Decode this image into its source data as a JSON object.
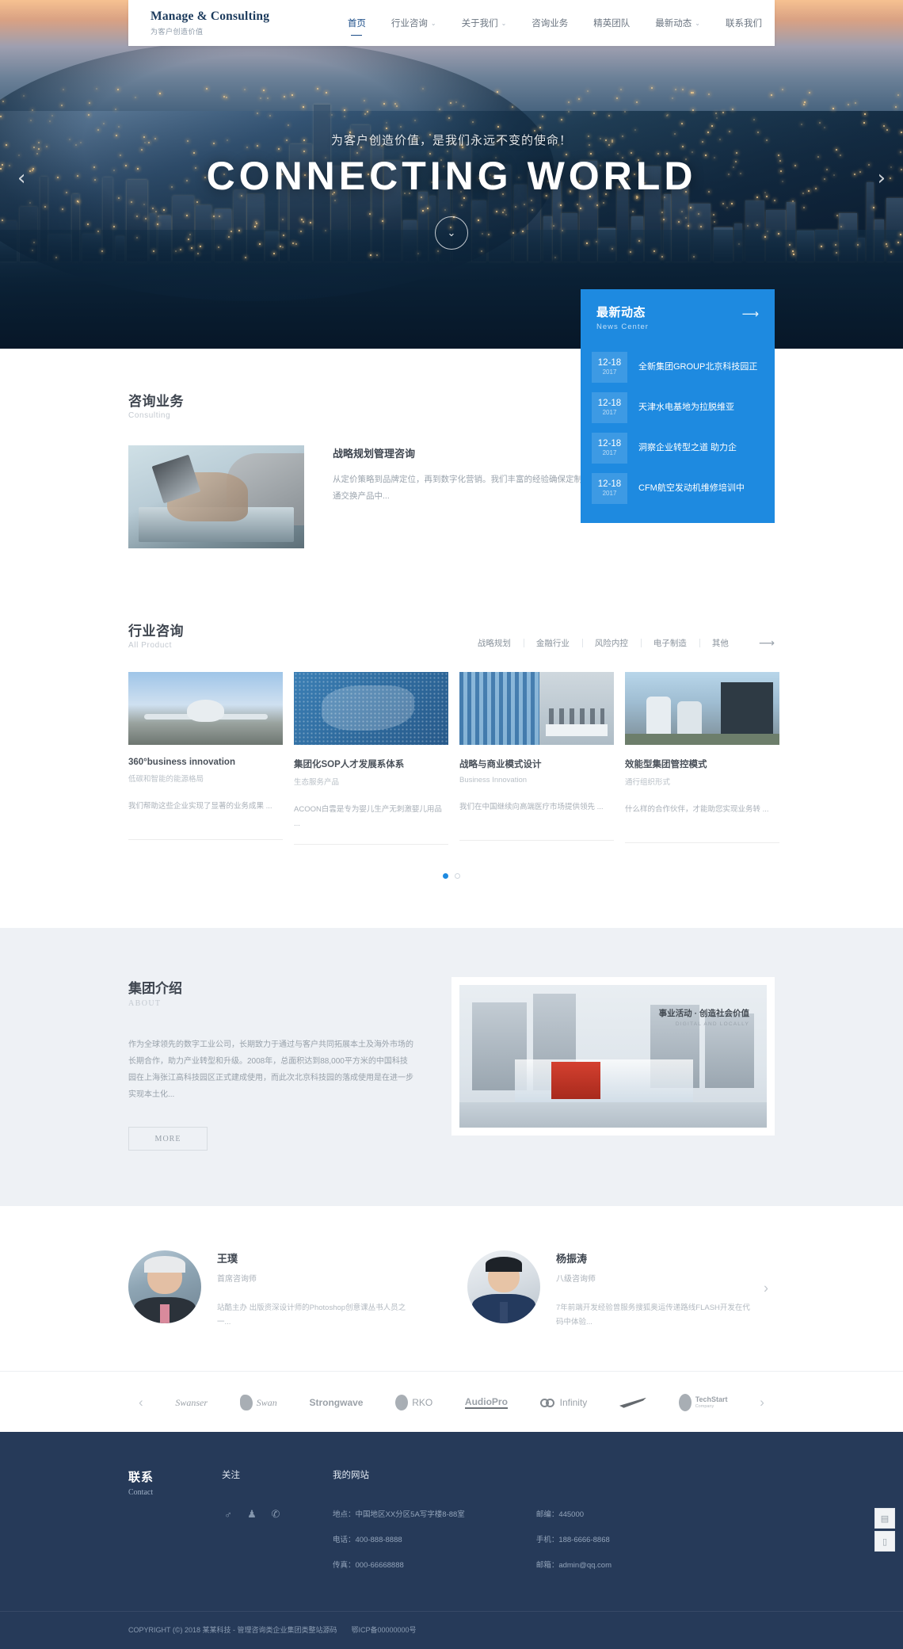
{
  "header": {
    "logo_main": "Manage & Consulting",
    "logo_sub": "为客户创造价值",
    "nav": [
      {
        "label": "首页",
        "caret": false,
        "active": true
      },
      {
        "label": "行业咨询",
        "caret": true,
        "active": false
      },
      {
        "label": "关于我们",
        "caret": true,
        "active": false
      },
      {
        "label": "咨询业务",
        "caret": false,
        "active": false
      },
      {
        "label": "精英团队",
        "caret": false,
        "active": false
      },
      {
        "label": "最新动态",
        "caret": true,
        "active": false
      },
      {
        "label": "联系我们",
        "caret": false,
        "active": false
      }
    ],
    "caret_glyph": "⌄"
  },
  "hero": {
    "subtitle": "为客户创造价值，是我们永远不变的使命！",
    "title": "CONNECTING WORLD",
    "play_glyph": "⌄",
    "prev_glyph": "‹",
    "next_glyph": "›"
  },
  "news": {
    "title": "最新动态",
    "subtitle": "News Center",
    "arrow": "⟶",
    "items": [
      {
        "day": "12-18",
        "year": "2017",
        "text": "全新集团GROUP北京科技园正"
      },
      {
        "day": "12-18",
        "year": "2017",
        "text": "天津水电基地为拉脱维亚"
      },
      {
        "day": "12-18",
        "year": "2017",
        "text": "洞察企业转型之道 助力企"
      },
      {
        "day": "12-18",
        "year": "2017",
        "text": "CFM航空发动机维修培训中"
      }
    ]
  },
  "consulting": {
    "title": "咨询业务",
    "subtitle": "Consulting",
    "dots": [
      true,
      false,
      false
    ],
    "item": {
      "heading": "战略规划管理咨询",
      "body": "从定价策略到品牌定位，再到数字化营销。我们丰富的经验确保定制方案，市场营销是在创造/沟通交换产品中..."
    }
  },
  "products": {
    "title": "行业咨询",
    "subtitle": "All Product",
    "filters": [
      "战略规划",
      "金融行业",
      "风险内控",
      "电子制造",
      "其他"
    ],
    "more_arrow": "⟶",
    "cards": [
      {
        "title": "360°business innovation",
        "subtitle": "低碳和智能的能源格局",
        "desc": "我们帮助这些企业实现了显著的业务成果 ..."
      },
      {
        "title": "集团化SOP人才发展系体系",
        "subtitle": "生态服务产品",
        "desc": "ACOON白雲是专为婴儿生产无刺激婴儿用品 ..."
      },
      {
        "title": "战略与商业模式设计",
        "subtitle": "Business Innovation",
        "desc": "我们在中国继续向高端医疗市场提供领先 ..."
      },
      {
        "title": "效能型集团管控模式",
        "subtitle": "通行组织形式",
        "desc": "什么样的合作伙伴，才能助您实现业务转 ..."
      }
    ],
    "dots": [
      true,
      false
    ]
  },
  "about": {
    "title": "集团介绍",
    "subtitle": "ABOUT",
    "body": "作为全球领先的数字工业公司，长期致力于通过与客户共同拓展本土及海外市场的长期合作，助力产业转型和升级。2008年，总面积达到88,000平方米的中国科技园在上海张江高科技园区正式建成使用，而此次北京科技园的落成使用是在进一步实现本土化...",
    "more_label": "MORE",
    "image_caption_cn": "事业活动 · 创造社会价值",
    "image_caption_en": "DIGITAL AND LOCALLY"
  },
  "team": {
    "prev_glyph": "‹",
    "next_glyph": "›",
    "members": [
      {
        "name": "王璞",
        "role": "首席咨询师",
        "bio": "站酷主办 出版资深设计师的Photoshop创意课丛书人员之一..."
      },
      {
        "name": "杨振涛",
        "role": "八级咨询师",
        "bio": "7年前端开发经验曾服务搜狐奥运传递路线FLASH开发在代码中体验..."
      }
    ]
  },
  "brands": {
    "prev_glyph": "‹",
    "next_glyph": "›",
    "items": [
      {
        "name": "Swanser",
        "style": "italic"
      },
      {
        "name": "Swan",
        "style": "swan"
      },
      {
        "name": "Strongwave",
        "style": "bold"
      },
      {
        "name": "RKO",
        "style": "badge"
      },
      {
        "name": "AudioPro",
        "style": "underline"
      },
      {
        "name": "Infinity",
        "style": "infinity"
      },
      {
        "name": "",
        "style": "swoosh"
      },
      {
        "name": "TechStart",
        "style": "badge2",
        "sub": "Company"
      }
    ]
  },
  "footer": {
    "contact_title": "联系",
    "contact_en": "Contact",
    "follow_title": "关注",
    "site_title": "我的网站",
    "socials": [
      "weibo-icon",
      "qq-icon",
      "wechat-icon"
    ],
    "social_glyphs": [
      "♂",
      "♟",
      "✆"
    ],
    "info_left": [
      "地点：中国地区XX分区5A写字楼8-88室",
      "电话：400-888-8888",
      "传真：000-66668888"
    ],
    "info_right": [
      "邮编：445000",
      "手机：188-6666-8868",
      "邮箱：admin@qq.com"
    ],
    "copyright": "COPYRIGHT (©) 2018 某某科技 - 管理咨询类企业集团类整站源码",
    "icp": "鄂ICP备00000000号"
  },
  "side_widget": {
    "icons": [
      "qrcode-icon",
      "phone-icon"
    ],
    "glyphs": [
      "▤",
      "▯"
    ]
  }
}
